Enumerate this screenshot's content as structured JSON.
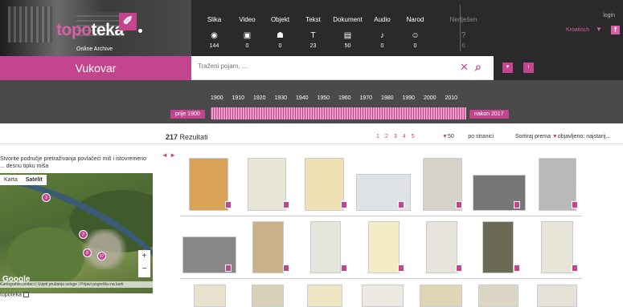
{
  "header": {
    "logo": {
      "part1": "topo",
      "part2": "teka"
    },
    "subtitle": "Online Archive",
    "login": "login",
    "language": "Kroatisch",
    "categories": [
      {
        "label": "Slika",
        "count": "144",
        "icon": "camera-icon"
      },
      {
        "label": "Video",
        "count": "0",
        "icon": "film-icon"
      },
      {
        "label": "Objekt",
        "count": "0",
        "icon": "bag-icon"
      },
      {
        "label": "Tekst",
        "count": "23",
        "icon": "text-icon"
      },
      {
        "label": "Dokument",
        "count": "50",
        "icon": "document-icon"
      },
      {
        "label": "Audio",
        "count": "0",
        "icon": "music-icon"
      },
      {
        "label": "Narod",
        "count": "0",
        "icon": "person-icon"
      },
      {
        "label": "Nerlješen",
        "count": "0",
        "icon": "question-icon"
      }
    ]
  },
  "search": {
    "place": "Vukovar",
    "placeholder": "Traženi pojam, ..."
  },
  "timeline": {
    "years": [
      "1900",
      "1910",
      "1920",
      "1930",
      "1940",
      "1950",
      "1960",
      "1970",
      "1980",
      "1990",
      "2000",
      "2010"
    ],
    "before": "prije 1900",
    "after": "nakon 2017"
  },
  "results": {
    "count": "217",
    "label": "Rezultati",
    "pages": [
      "1",
      "2",
      "3",
      "4",
      "5"
    ],
    "per_page": "50",
    "per_page_label": "po stranici",
    "sort_label": "Sortiraj prema",
    "sort_value": "objavljeno: najstarij..."
  },
  "map": {
    "instruction": "Stvorite područje pretraživanja povlačeći miš i istovremeno ... desnu tipku miša",
    "tabs": [
      "Karta",
      "Satelit"
    ],
    "pins": [
      "3",
      "2",
      "8",
      "37"
    ],
    "footer": "Kartografski podaci | Uvjeti pružanja usluge | Prijavi pogrešku na karti",
    "google": "Google",
    "checkbox_label": "topoteka"
  },
  "colors": {
    "accent": "#c2458e",
    "dark": "#2a2a2a"
  }
}
